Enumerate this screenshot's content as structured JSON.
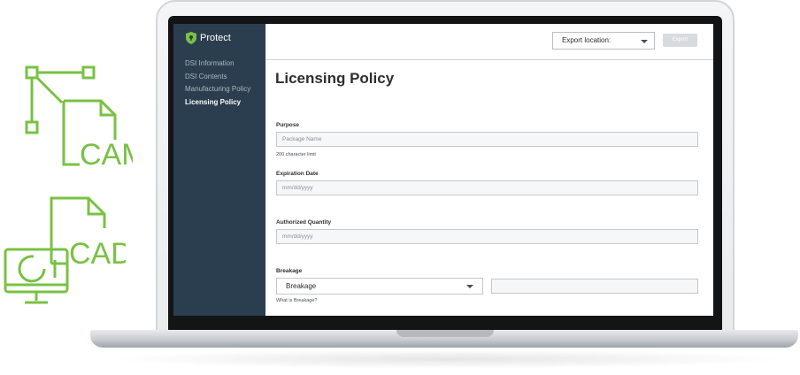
{
  "decor": {
    "cam_label": "CAM",
    "cad_label": "CAD",
    "icon_color": "#79c143"
  },
  "app": {
    "brand": "Protect",
    "accent": "#79c143"
  },
  "sidebar": {
    "items": [
      {
        "label": "DSI Information",
        "active": false
      },
      {
        "label": "DSI Contents",
        "active": false
      },
      {
        "label": "Manufacturing Policy",
        "active": false
      },
      {
        "label": "Licensing Policy",
        "active": true
      }
    ]
  },
  "toolbar": {
    "export_location_label": "Export location:",
    "export_button_label": "Export"
  },
  "main": {
    "title": "Licensing Policy",
    "purpose": {
      "label": "Purpose",
      "placeholder": "Package Name",
      "help": "200 character limit"
    },
    "expiration": {
      "label": "Expiration Date",
      "placeholder": "mm/dd/yyyy"
    },
    "quantity": {
      "label": "Authorized Quantity",
      "placeholder": "mm/dd/yyyy"
    },
    "breakage": {
      "label": "Breakage",
      "selected": "Breakage",
      "help": "What is Breakage?"
    }
  }
}
